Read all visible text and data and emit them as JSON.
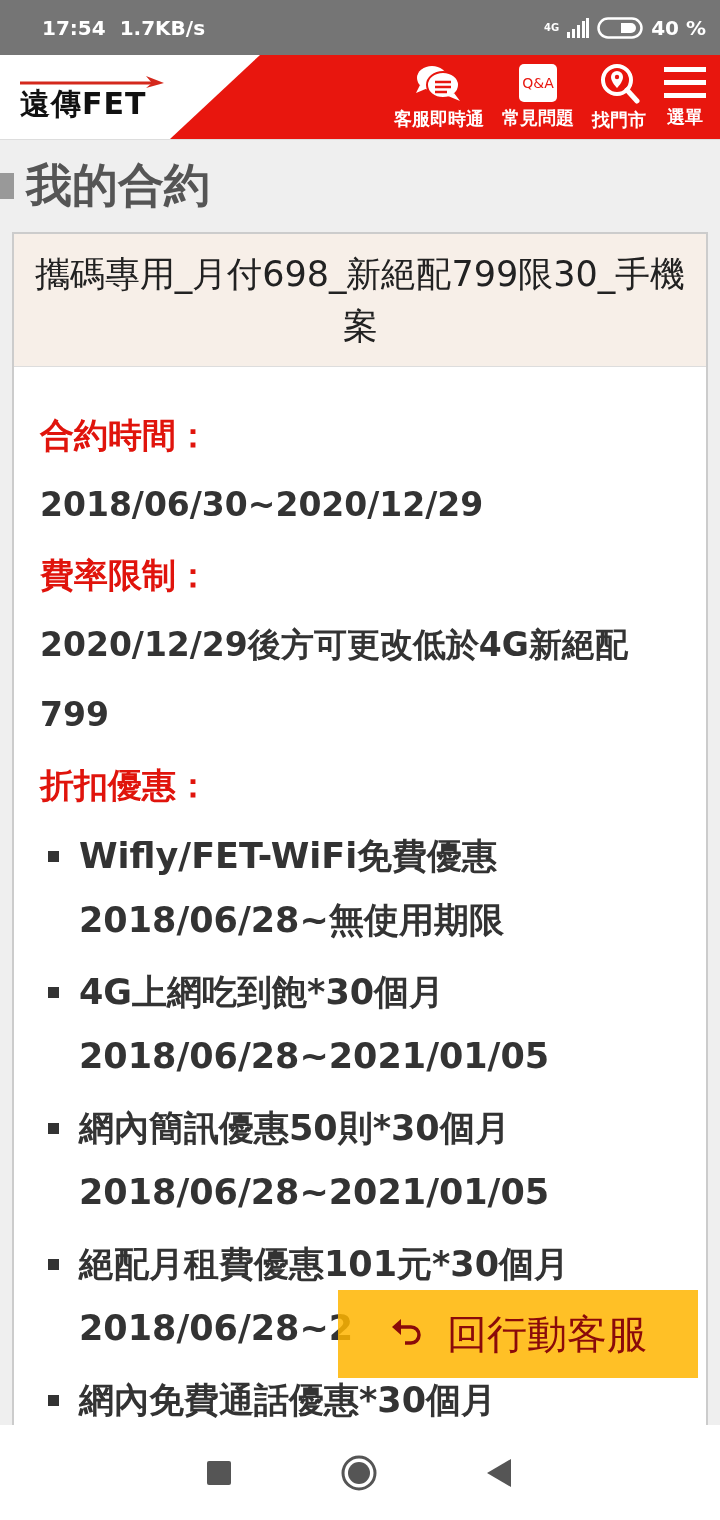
{
  "status_bar": {
    "time": "17:54",
    "speed": "1.7KB/s",
    "network": "4G",
    "battery": "40 %"
  },
  "header": {
    "logo": "遠傳FET",
    "actions": [
      {
        "kind": "chat",
        "label": "客服即時通"
      },
      {
        "kind": "qa",
        "label": "常見問題",
        "icon_text": "Q&A"
      },
      {
        "kind": "store",
        "label": "找門市"
      },
      {
        "kind": "menu",
        "label": "選單"
      }
    ]
  },
  "page_title": "我的合約",
  "contract": {
    "name": "攜碼專用_月付698_新絕配799限30_手機案",
    "sections": [
      {
        "label": "合約時間：",
        "value": "2018/06/30~2020/12/29"
      },
      {
        "label": "費率限制：",
        "value": "2020/12/29後方可更改低於4G新絕配799"
      },
      {
        "label": "折扣優惠：",
        "items": [
          {
            "title": "Wifly/FET-WiFi免費優惠",
            "period": "2018/06/28~無使用期限"
          },
          {
            "title": "4G上網吃到飽*30個月",
            "period": "2018/06/28~2021/01/05"
          },
          {
            "title": "網內簡訊優惠50則*30個月",
            "period": "2018/06/28~2021/01/05"
          },
          {
            "title": "絕配月租費優惠101元*30個月",
            "period": "2018/06/28~2"
          },
          {
            "title": "網內免費通話優惠*30個月"
          }
        ]
      }
    ]
  },
  "floating_button": {
    "label": "回行動客服"
  }
}
